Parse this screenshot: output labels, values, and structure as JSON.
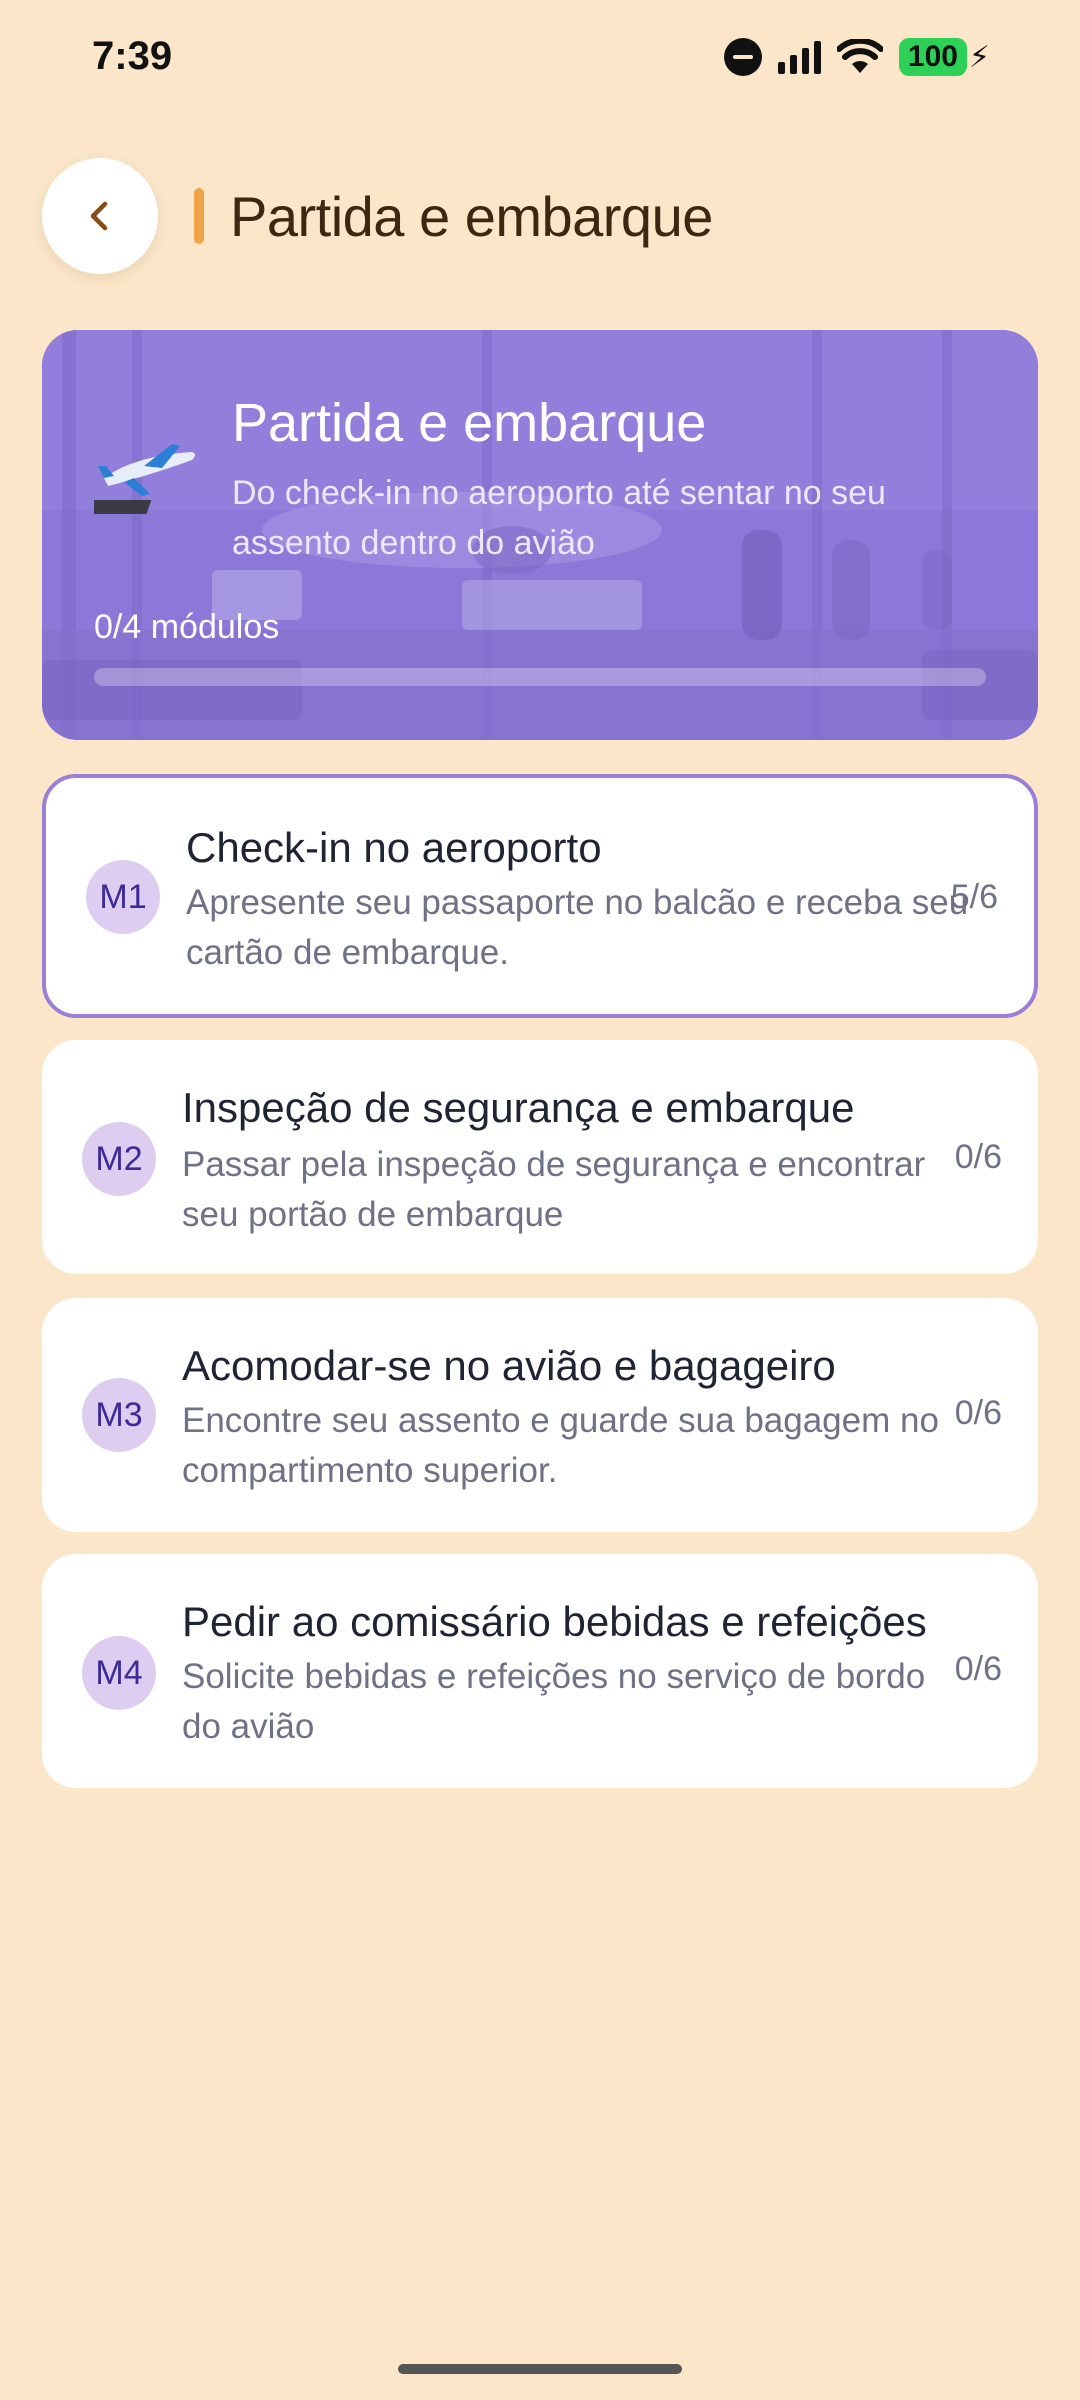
{
  "status_bar": {
    "time": "7:39",
    "battery": "100"
  },
  "header": {
    "title": "Partida e embarque"
  },
  "hero": {
    "title": "Partida e embarque",
    "subtitle": "Do check-in no aeroporto até sentar no seu assento dentro do avião",
    "progress_text": "0/4 módulos",
    "progress_fraction": 0
  },
  "modules": [
    {
      "badge": "M1",
      "title": "Check-in no aeroporto",
      "desc": "Apresente seu passaporte no balcão e receba seu cartão de embarque.",
      "progress": "5/6",
      "active": true
    },
    {
      "badge": "M2",
      "title": "Inspeção de segurança e embarque",
      "desc": "Passar pela inspeção de segurança e encontrar seu portão de embarque",
      "progress": "0/6",
      "active": false
    },
    {
      "badge": "M3",
      "title": "Acomodar-se no avião e bagageiro",
      "desc": "Encontre seu assento e guarde sua bagagem no compartimento superior.",
      "progress": "0/6",
      "active": false
    },
    {
      "badge": "M4",
      "title": "Pedir ao comissário bebidas e refeições",
      "desc": "Solicite bebidas e refeições no serviço de bordo do avião",
      "progress": "0/6",
      "active": false
    }
  ],
  "colors": {
    "background": "#fbe6c9",
    "accent": "#f0a54a",
    "hero": "#8b76d6",
    "badge": "#dccdf1",
    "active_border": "#9a7fd6"
  }
}
